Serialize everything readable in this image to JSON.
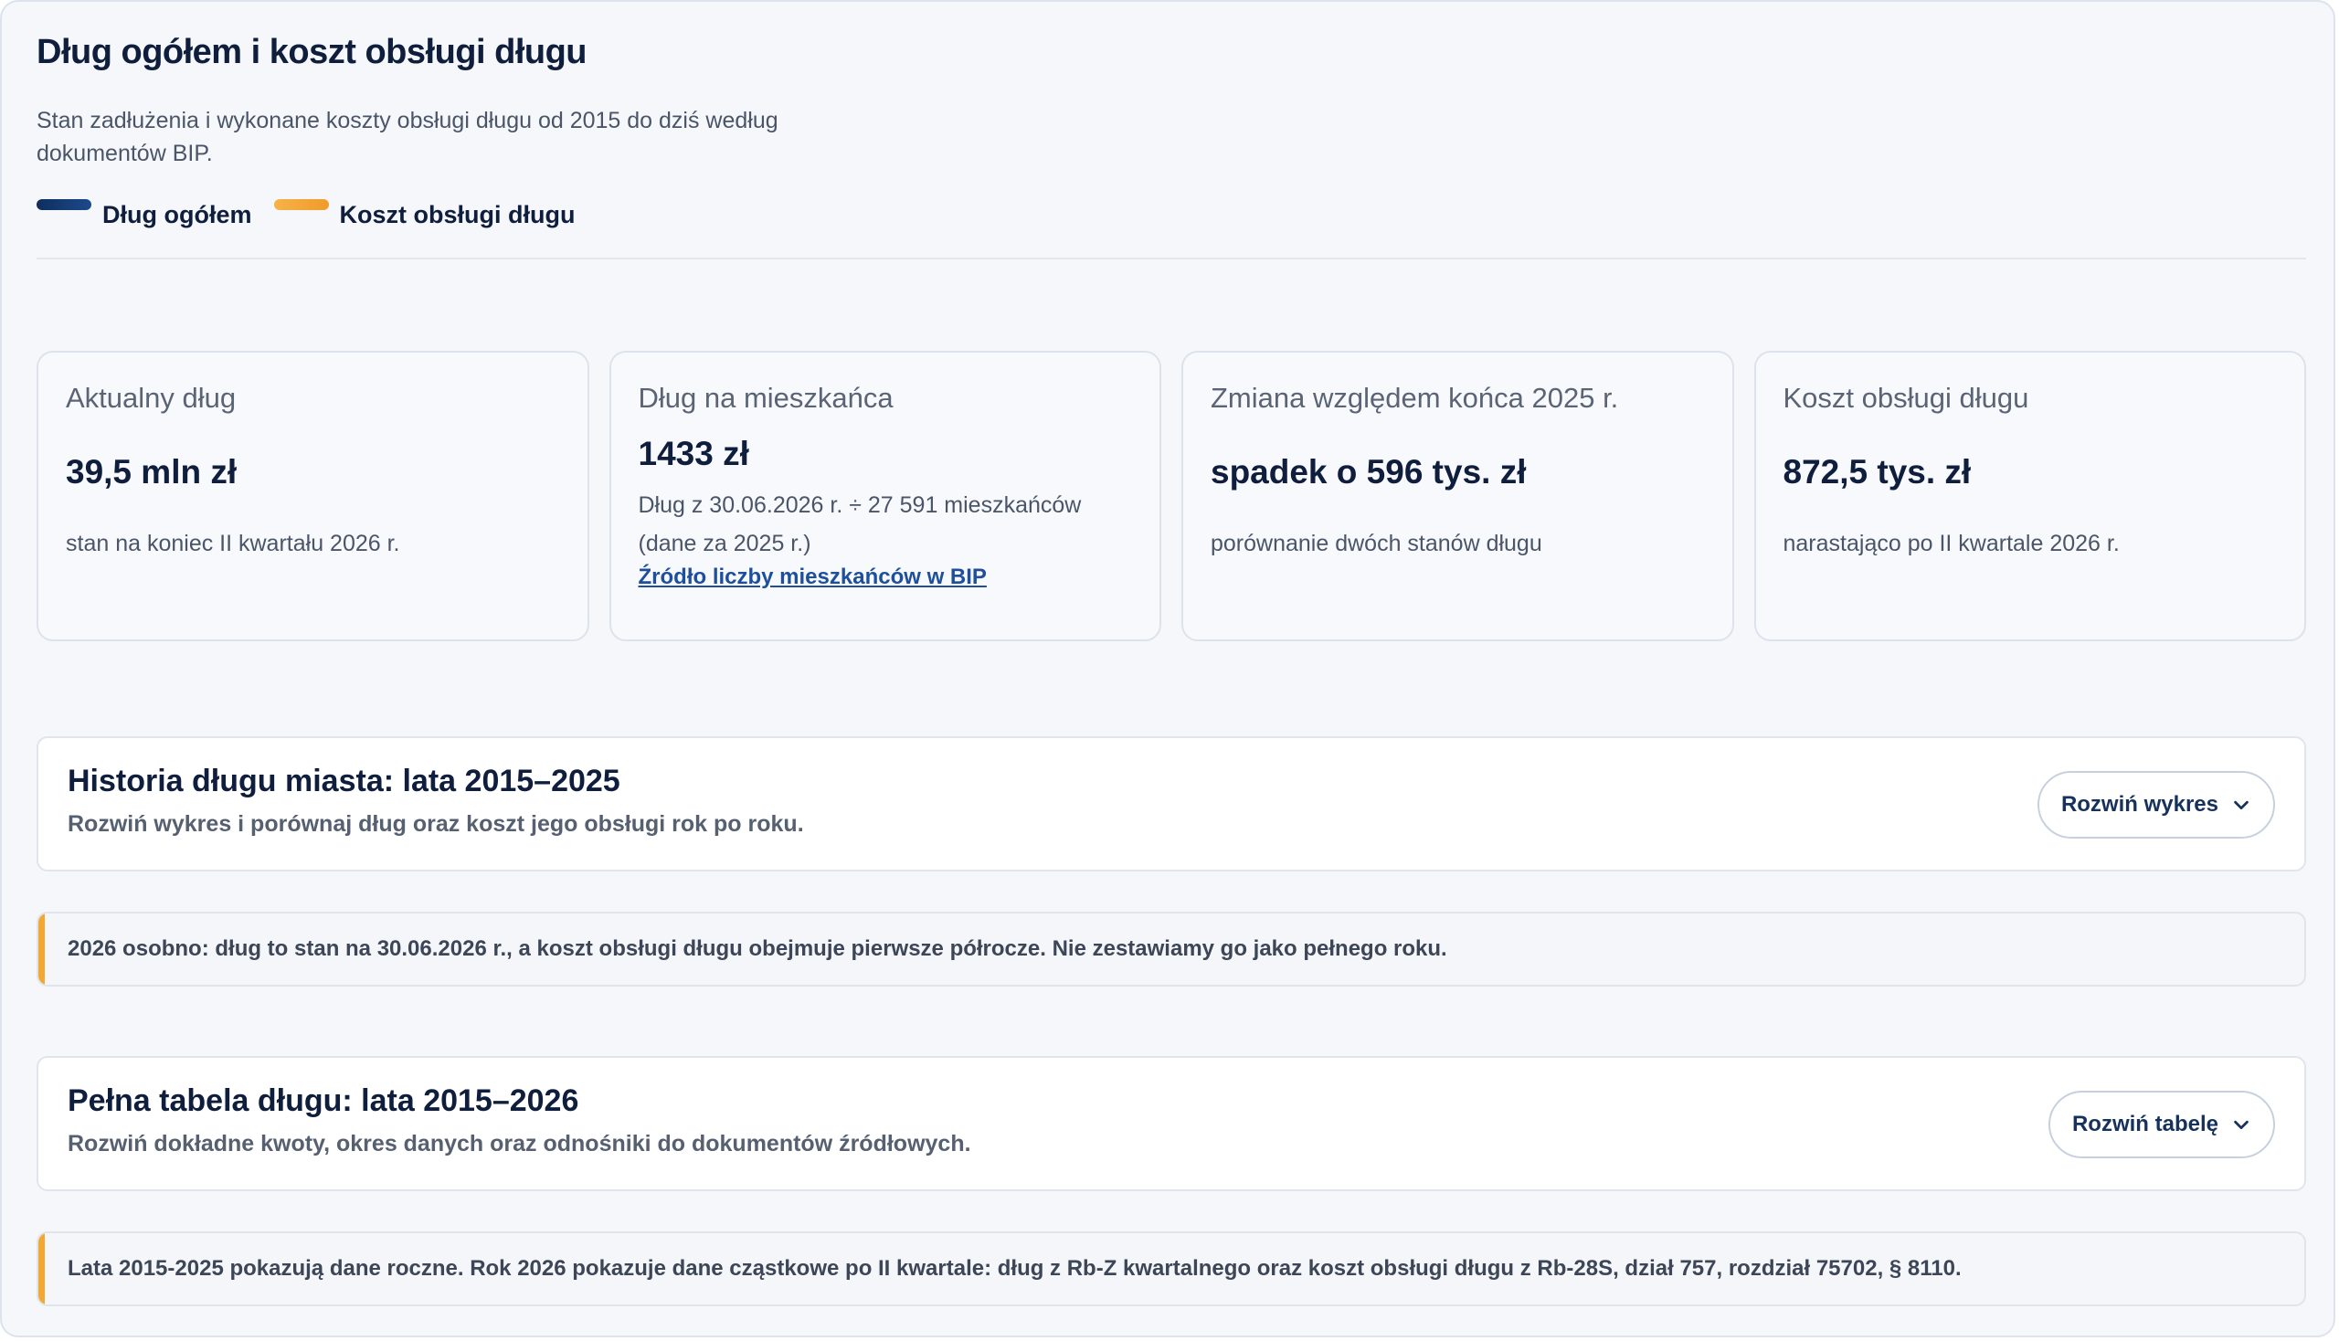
{
  "header": {
    "title": "Dług ogółem i koszt obsługi długu",
    "subtitle": "Stan zadłużenia i wykonane koszty obsługi długu od 2015 do dziś według dokumentów BIP."
  },
  "legend": [
    {
      "label": "Dług ogółem",
      "color": "#0f2e5c"
    },
    {
      "label": "Koszt obsługi długu",
      "color": "#f2a833"
    }
  ],
  "cards": [
    {
      "label": "Aktualny dług",
      "value": "39,5 mln zł",
      "note": "stan na koniec II kwartału 2026 r."
    },
    {
      "label": "Dług na mieszkańca",
      "value": "1433 zł",
      "note": "Dług z 30.06.2026 r. ÷ 27 591 mieszkańców (dane za 2025 r.)",
      "link": "Źródło liczby mieszkańców w BIP"
    },
    {
      "label": "Zmiana względem końca 2025 r.",
      "value": "spadek o 596 tys. zł",
      "note": "porównanie dwóch stanów długu"
    },
    {
      "label": "Koszt obsługi długu",
      "value": "872,5 tys. zł",
      "note": "narastająco po II kwartale 2026 r."
    }
  ],
  "history": {
    "title": "Historia długu miasta: lata 2015–2025",
    "desc": "Rozwiń wykres i porównaj dług oraz koszt jego obsługi rok po roku.",
    "button": "Rozwiń wykres"
  },
  "note1": "2026 osobno: dług to stan na 30.06.2026 r., a koszt obsługi długu obejmuje pierwsze półrocze. Nie zestawiamy go jako pełnego roku.",
  "table": {
    "title": "Pełna tabela długu: lata 2015–2026",
    "desc": "Rozwiń dokładne kwoty, okres danych oraz odnośniki do dokumentów źródłowych.",
    "button": "Rozwiń tabelę"
  },
  "note2": "Lata 2015-2025 pokazują dane roczne. Rok 2026 pokazuje dane cząstkowe po II kwartale: dług z Rb-Z kwartalnego oraz koszt obsługi długu z Rb-28S, dział 757, rozdział 75702, § 8110.",
  "colors": {
    "accent": "#f2a833",
    "navy": "#0f2e5c",
    "link": "#1d4f9c"
  }
}
